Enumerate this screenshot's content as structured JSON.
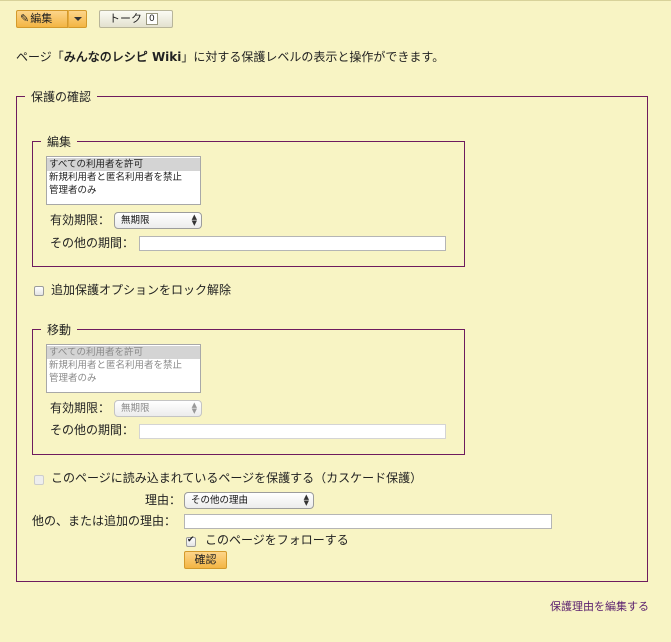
{
  "toolbar": {
    "edit_label": "編集",
    "talk_label": "トーク",
    "talk_count": "0"
  },
  "intro": {
    "prefix": "ページ「",
    "page_name": "みんなのレシピ Wiki",
    "suffix": "」に対する保護レベルの表示と操作ができます。"
  },
  "protect": {
    "legend": "保護の確認",
    "edit": {
      "legend": "編集",
      "options": [
        "すべての利用者を許可",
        "新規利用者と匿名利用者を禁止",
        "管理者のみ"
      ],
      "selected_index": 0,
      "expiry_label": "有効期限：",
      "expiry_value": "無期限",
      "other_label": "その他の期間：",
      "other_value": ""
    },
    "unlock_label": "追加保護オプションをロック解除",
    "move": {
      "legend": "移動",
      "options": [
        "すべての利用者を許可",
        "新規利用者と匿名利用者を禁止",
        "管理者のみ"
      ],
      "selected_index": 0,
      "expiry_label": "有効期限：",
      "expiry_value": "無期限",
      "other_label": "その他の期間：",
      "other_value": ""
    },
    "cascade_label": "このページに読み込まれているページを保護する（カスケード保護）",
    "reason_label": "理由：",
    "reason_value": "その他の理由",
    "other_reason_label": "他の、または追加の理由：",
    "other_reason_value": "",
    "watch_label": "このページをフォローする",
    "watch_checked": true,
    "confirm_label": "確認"
  },
  "footer": {
    "edit_reasons_link": "保護理由を編集する"
  }
}
